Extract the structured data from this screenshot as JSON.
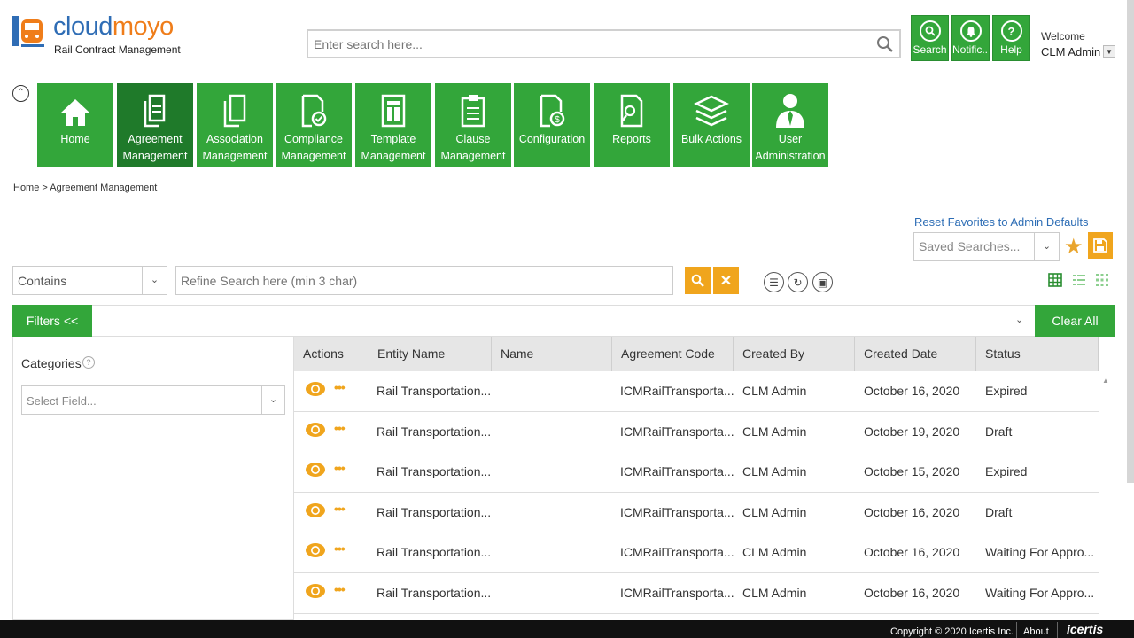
{
  "header": {
    "brand_part1": "cloud",
    "brand_part2": "moyo",
    "tagline": "Rail Contract Management",
    "search_placeholder": "Enter search here...",
    "buttons": [
      {
        "label": "Search",
        "icon": "search-icon"
      },
      {
        "label": "Notific...",
        "icon": "bell-icon"
      },
      {
        "label": "Help",
        "icon": "help-icon"
      }
    ],
    "welcome": "Welcome",
    "username": "CLM Admin"
  },
  "modules": [
    {
      "label": "Home",
      "icon": "home-icon"
    },
    {
      "label": "Agreement Management",
      "icon": "agreement-icon",
      "active": true
    },
    {
      "label": "Association Management",
      "icon": "association-icon"
    },
    {
      "label": "Compliance Management",
      "icon": "compliance-icon"
    },
    {
      "label": "Template Management",
      "icon": "template-icon"
    },
    {
      "label": "Clause Management",
      "icon": "clause-icon"
    },
    {
      "label": "Configuration",
      "icon": "configuration-icon"
    },
    {
      "label": "Reports",
      "icon": "reports-icon"
    },
    {
      "label": "Bulk Actions",
      "icon": "layers-icon"
    },
    {
      "label": "User Administration",
      "icon": "user-icon"
    }
  ],
  "breadcrumb": {
    "home": "Home",
    "separator": ">",
    "current": "Agreement Management"
  },
  "favorites": {
    "reset_label": "Reset Favorites to Admin Defaults",
    "saved_searches_placeholder": "Saved Searches..."
  },
  "search_bar": {
    "operator": "Contains",
    "refine_placeholder": "Refine Search here (min 3 char)"
  },
  "filters": {
    "filters_label": "Filters <<",
    "clear_all_label": "Clear All",
    "categories_label": "Categories",
    "select_field_placeholder": "Select Field..."
  },
  "grid": {
    "columns": [
      "Actions",
      "Entity Name",
      "Name",
      "Agreement Code",
      "Created By",
      "Created Date",
      "Status"
    ],
    "rows": [
      {
        "entity": "Rail Transportation...",
        "name": "",
        "code": "ICMRailTransporta...",
        "created_by": "CLM Admin",
        "date": "October 16, 2020",
        "status": "Expired"
      },
      {
        "entity": "Rail Transportation...",
        "name": "",
        "code": "ICMRailTransporta...",
        "created_by": "CLM Admin",
        "date": "October 19, 2020",
        "status": "Draft"
      },
      {
        "entity": "Rail Transportation...",
        "name": "",
        "code": "ICMRailTransporta...",
        "created_by": "CLM Admin",
        "date": "October 15, 2020",
        "status": "Expired"
      },
      {
        "entity": "Rail Transportation...",
        "name": "",
        "code": "ICMRailTransporta...",
        "created_by": "CLM Admin",
        "date": "October 16, 2020",
        "status": "Draft"
      },
      {
        "entity": "Rail Transportation...",
        "name": "",
        "code": "ICMRailTransporta...",
        "created_by": "CLM Admin",
        "date": "October 16, 2020",
        "status": "Waiting For Appro..."
      },
      {
        "entity": "Rail Transportation...",
        "name": "",
        "code": "ICMRailTransporta...",
        "created_by": "CLM Admin",
        "date": "October 16, 2020",
        "status": "Waiting For Appro..."
      }
    ]
  },
  "footer": {
    "copyright": "Copyright © 2020 Icertis Inc.",
    "about": "About",
    "logo": "icertis"
  },
  "colors": {
    "green": "#33a63a",
    "green_active": "#1f7a2a",
    "orange": "#f0a51d",
    "link_blue": "#2d6db5"
  }
}
